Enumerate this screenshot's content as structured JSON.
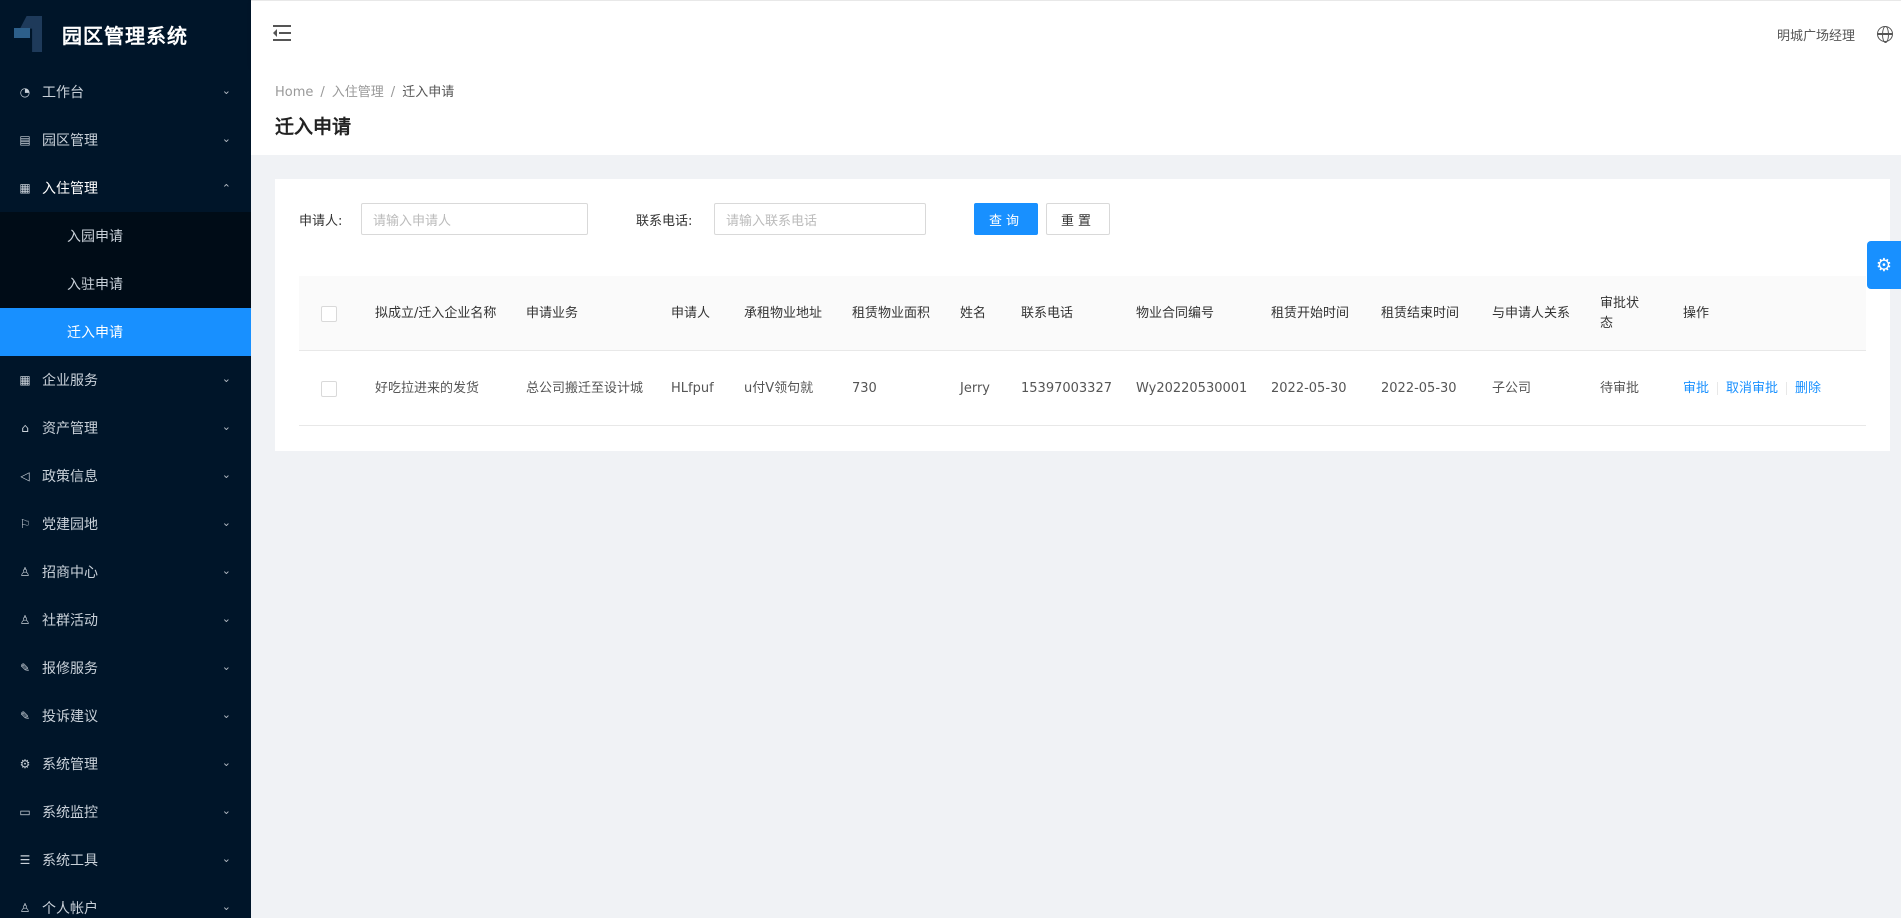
{
  "app": {
    "title": "园区管理系统"
  },
  "sidebar": {
    "items": [
      {
        "label": "工作台",
        "icon": "dashboard-icon",
        "glyph": "◔"
      },
      {
        "label": "园区管理",
        "icon": "building-icon",
        "glyph": "▤"
      },
      {
        "label": "入住管理",
        "icon": "document-icon",
        "glyph": "▦"
      },
      {
        "label": "企业服务",
        "icon": "grid-icon",
        "glyph": "▦"
      },
      {
        "label": "资产管理",
        "icon": "bank-icon",
        "glyph": "⌂"
      },
      {
        "label": "政策信息",
        "icon": "megaphone-icon",
        "glyph": "◁"
      },
      {
        "label": "党建园地",
        "icon": "flag-icon",
        "glyph": "⚐"
      },
      {
        "label": "招商中心",
        "icon": "user-search-icon",
        "glyph": "♙"
      },
      {
        "label": "社群活动",
        "icon": "people-icon",
        "glyph": "♙"
      },
      {
        "label": "报修服务",
        "icon": "wrench-icon",
        "glyph": "✎"
      },
      {
        "label": "投诉建议",
        "icon": "edit-icon",
        "glyph": "✎"
      },
      {
        "label": "系统管理",
        "icon": "gear-icon",
        "glyph": "⚙"
      },
      {
        "label": "系统监控",
        "icon": "video-icon",
        "glyph": "▭"
      },
      {
        "label": "系统工具",
        "icon": "list-icon",
        "glyph": "☰"
      },
      {
        "label": "个人帐户",
        "icon": "user-icon",
        "glyph": "♙"
      }
    ],
    "submenu": [
      {
        "label": "入园申请"
      },
      {
        "label": "入驻申请"
      },
      {
        "label": "迁入申请"
      }
    ]
  },
  "header": {
    "user": "明城广场经理"
  },
  "breadcrumb": [
    "Home",
    "入住管理",
    "迁入申请"
  ],
  "page": {
    "title": "迁入申请"
  },
  "search": {
    "applicant_label": "申请人:",
    "applicant_placeholder": "请输入申请人",
    "phone_label": "联系电话:",
    "phone_placeholder": "请输入联系电话",
    "query_button": "查询",
    "reset_button": "重置"
  },
  "table": {
    "columns": [
      "拟成立/迁入企业名称",
      "申请业务",
      "申请人",
      "承租物业地址",
      "租赁物业面积",
      "姓名",
      "联系电话",
      "物业合同编号",
      "租赁开始时间",
      "租赁结束时间",
      "与申请人关系",
      "审批状态",
      "操作"
    ],
    "rows": [
      {
        "company": "好吃拉进来的发货",
        "business": "总公司搬迁至设计城",
        "applicant": "HLfpuf",
        "address": "u付V领句就",
        "area": "730",
        "name": "Jerry",
        "phone": "15397003327",
        "contract": "Wy20220530001",
        "start": "2022-05-30",
        "end": "2022-05-30",
        "relation": "子公司",
        "status": "待审批",
        "actions": [
          "审批",
          "取消审批",
          "删除"
        ]
      }
    ]
  },
  "colors": {
    "sidebar_bg": "#001529",
    "accent": "#1890ff"
  }
}
